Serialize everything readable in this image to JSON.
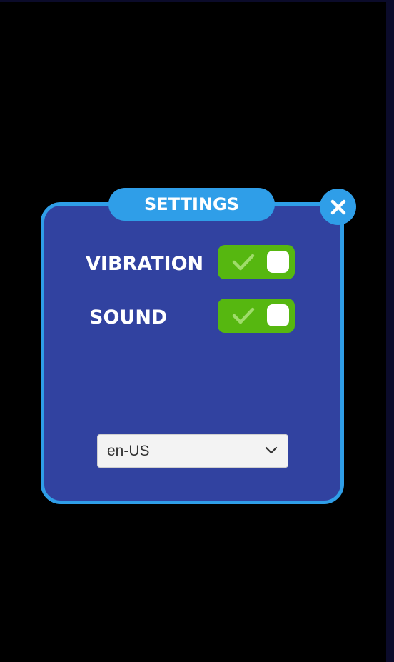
{
  "settings": {
    "title": "SETTINGS",
    "close_icon": "close-icon",
    "rows": [
      {
        "label": "VIBRATION",
        "enabled": true,
        "icon": "check-icon"
      },
      {
        "label": "SOUND",
        "enabled": true,
        "icon": "check-icon"
      }
    ],
    "language": {
      "selected": "en-US",
      "icon": "chevron-down-icon"
    }
  },
  "colors": {
    "background": "#000000",
    "panel_fill": "#3142a0",
    "panel_border": "#2f9ee8",
    "toggle_on": "#56b710",
    "dropdown_bg": "#f3f3f3"
  }
}
